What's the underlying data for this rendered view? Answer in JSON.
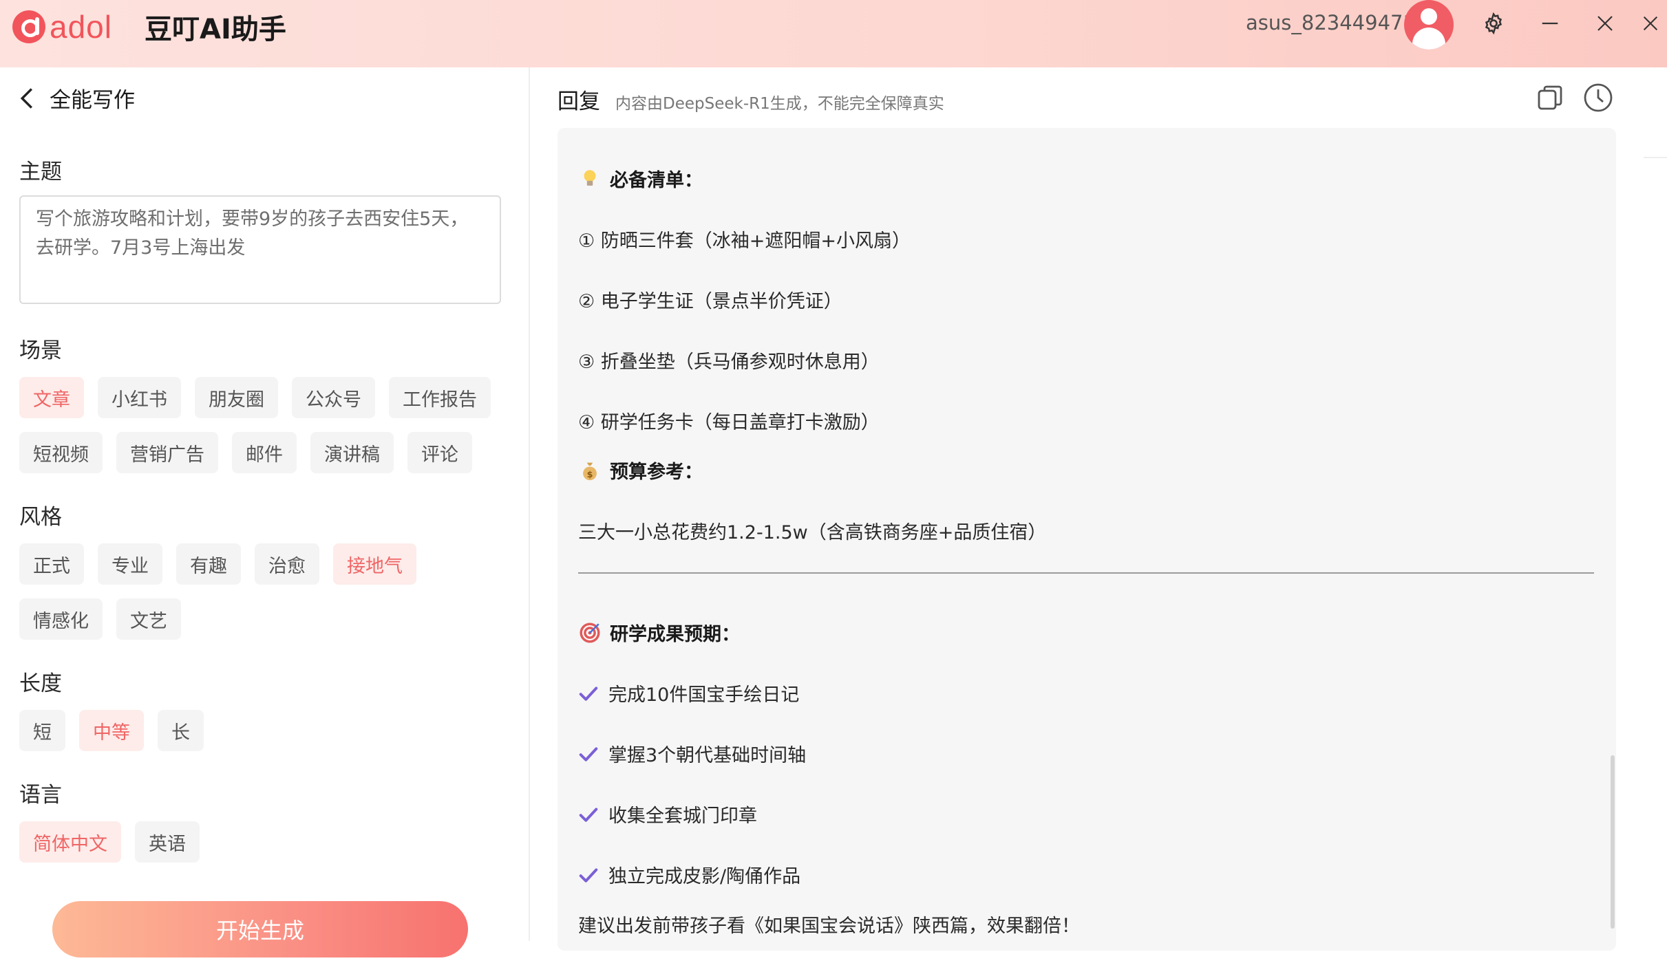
{
  "titlebar": {
    "logo_text": "adol",
    "app_title": "豆叮AI助手",
    "username": "asus_823449471",
    "icons": [
      "avatar",
      "gear-icon",
      "minimize-icon",
      "close-icon"
    ]
  },
  "left": {
    "back_title": "全能写作",
    "topic": {
      "label": "主题",
      "value": "写个旅游攻略和计划，要带9岁的孩子去西安住5天，去研学。7月3号上海出发"
    },
    "scene": {
      "label": "场景",
      "row1": [
        "文章",
        "小红书",
        "朋友圈",
        "公众号",
        "工作报告"
      ],
      "row2": [
        "短视频",
        "营销广告",
        "邮件",
        "演讲稿",
        "评论"
      ],
      "selected": "文章"
    },
    "style": {
      "label": "风格",
      "row1": [
        "正式",
        "专业",
        "有趣",
        "治愈",
        "接地气"
      ],
      "row2": [
        "情感化",
        "文艺"
      ],
      "selected": "接地气"
    },
    "length": {
      "label": "长度",
      "options": [
        "短",
        "中等",
        "长"
      ],
      "selected": "中等"
    },
    "language": {
      "label": "语言",
      "options": [
        "简体中文",
        "英语"
      ],
      "selected": "简体中文"
    },
    "generate_label": "开始生成"
  },
  "right": {
    "title": "回复",
    "note": "内容由DeepSeek-R1生成，不能完全保障真实",
    "content": {
      "checklist_title": "必备清单：",
      "checklist": [
        "① 防晒三件套（冰袖+遮阳帽+小风扇）",
        "② 电子学生证（景点半价凭证）",
        "③ 折叠坐垫（兵马俑参观时休息用）",
        "④ 研学任务卡（每日盖章打卡激励）"
      ],
      "budget_title": "预算参考：",
      "budget_text": "三大一小总花费约1.2-1.5w（含高铁商务座+品质住宿）",
      "outcome_title": "研学成果预期：",
      "outcomes": [
        "完成10件国宝手绘日记",
        "掌握3个朝代基础时间轴",
        "收集全套城门印章",
        "独立完成皮影/陶俑作品"
      ],
      "closing": "建议出发前带孩子看《如果国宝会说话》陕西篇，效果翻倍！"
    }
  },
  "colors": {
    "accent": "#f06565",
    "chip_bg": "#f4f4f4",
    "chip_active_bg": "#fdecea",
    "check": "#7b5fd6"
  }
}
